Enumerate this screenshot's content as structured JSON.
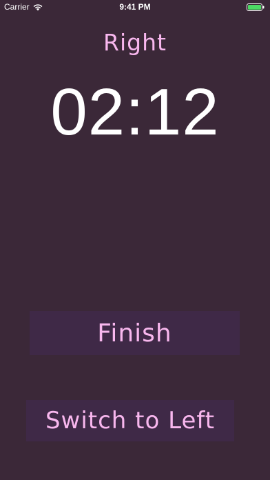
{
  "status_bar": {
    "carrier": "Carrier",
    "time": "9:41 PM",
    "battery_color": "#4cd964"
  },
  "main": {
    "side_label": "Right",
    "timer": "02:12",
    "finish_label": "Finish",
    "switch_label": "Switch to Left"
  },
  "colors": {
    "background": "#3b2838",
    "accent": "#f8b7ee",
    "button_bg": "#3f2947"
  }
}
